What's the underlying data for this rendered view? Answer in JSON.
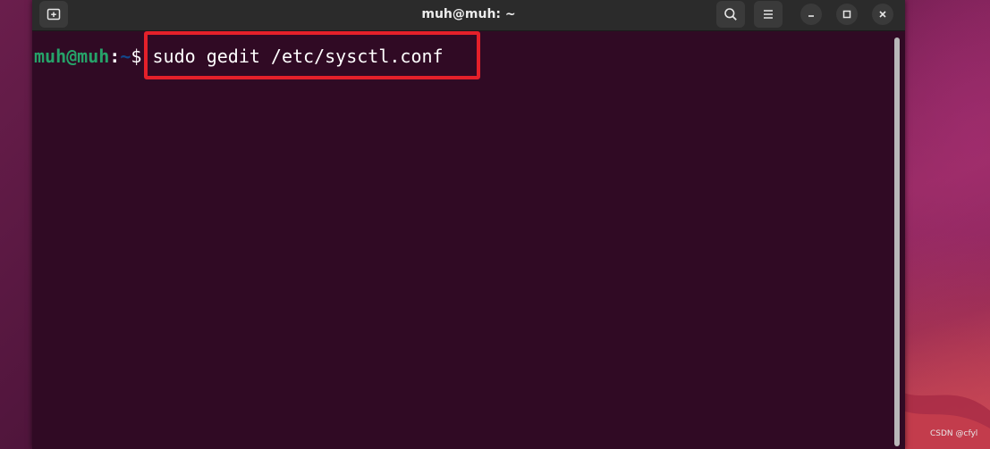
{
  "window": {
    "title": "muh@muh: ~"
  },
  "terminal": {
    "prompt_user": "muh@muh",
    "prompt_colon": ":",
    "prompt_path": "~",
    "prompt_symbol": "$",
    "command": "sudo gedit /etc/sysctl.conf"
  },
  "icons": {
    "new_tab": "new-tab-icon",
    "search": "search-icon",
    "menu": "hamburger-menu-icon",
    "minimize": "minimize-icon",
    "maximize": "maximize-icon",
    "close": "close-icon"
  },
  "colors": {
    "terminal_bg": "#300a24",
    "titlebar_bg": "#2b2b2b",
    "prompt_user": "#26a269",
    "prompt_path": "#12488b",
    "highlight_border": "#e4202a"
  },
  "watermark": "CSDN @cfyl"
}
